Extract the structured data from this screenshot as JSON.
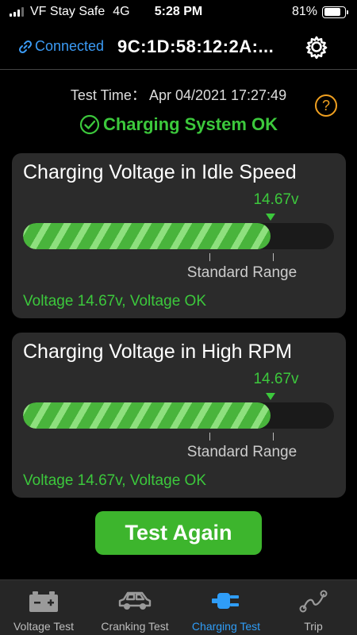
{
  "status_bar": {
    "carrier": "VF Stay Safe",
    "network": "4G",
    "time": "5:28 PM",
    "battery_text": "81%",
    "battery_level": 0.81,
    "signal_bars": 3
  },
  "header": {
    "connected_label": "Connected",
    "device_id": "9C:1D:58:12:2A:..."
  },
  "test_time": {
    "label": "Test Time：",
    "value": "Apr 04/2021 17:27:49"
  },
  "system_status": "Charging System OK",
  "cards": [
    {
      "title": "Charging Voltage in Idle Speed",
      "reading": "14.67v",
      "fill_fraction": 0.795,
      "range_label": "Standard Range",
      "result": "Voltage 14.67v, Voltage OK"
    },
    {
      "title": "Charging Voltage in High RPM",
      "reading": "14.67v",
      "fill_fraction": 0.795,
      "range_label": "Standard Range",
      "result": "Voltage 14.67v, Voltage OK"
    }
  ],
  "actions": {
    "test_again_label": "Test Again"
  },
  "tabs": [
    {
      "label": "Voltage Test",
      "icon": "battery-icon",
      "active": false
    },
    {
      "label": "Cranking Test",
      "icon": "car-icon",
      "active": false
    },
    {
      "label": "Charging Test",
      "icon": "plug-icon",
      "active": true
    },
    {
      "label": "Trip",
      "icon": "route-icon",
      "active": false
    }
  ],
  "colors": {
    "accent_blue": "#2f9df7",
    "ok_green": "#3cc83c",
    "button_green": "#3db52d",
    "help_orange": "#f0a020"
  }
}
